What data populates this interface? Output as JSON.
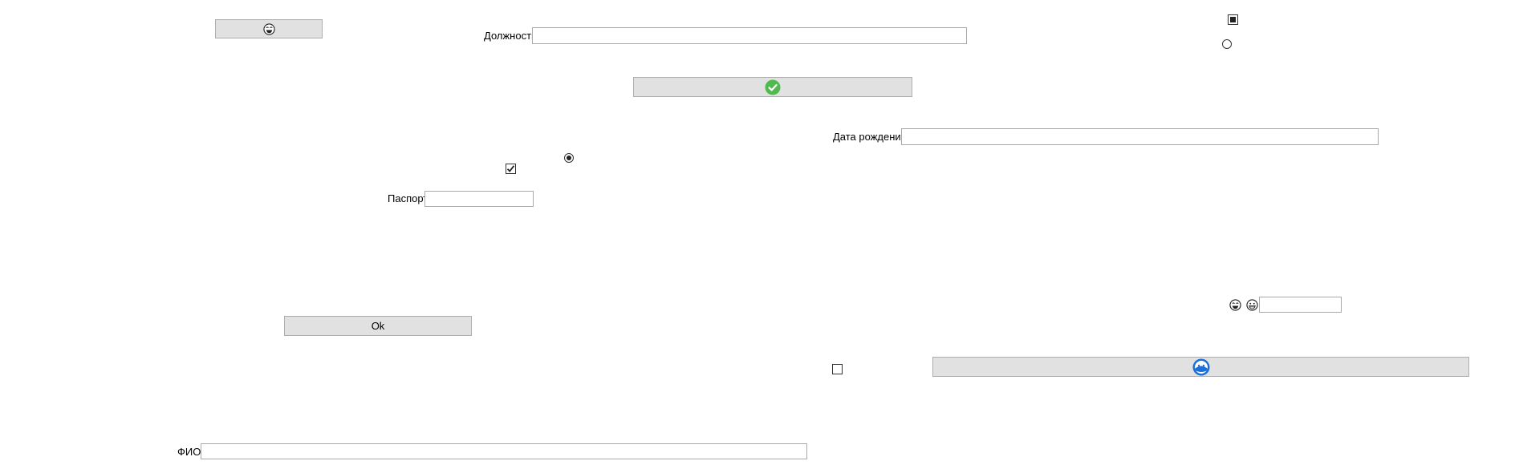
{
  "labels": {
    "position": "Должность",
    "birth_date": "Дата рождения",
    "passport": "Паспорт",
    "fio": "ФИО"
  },
  "buttons": {
    "ok_label": "Ok"
  },
  "fields": {
    "position_value": "",
    "birth_date_value": "",
    "passport_value": "",
    "fio_value": "",
    "small_value": ""
  },
  "states": {
    "checkbox_top_right": "indeterminate",
    "checkbox_middle": "checked",
    "checkbox_bottom": "unchecked",
    "radio_top_right": "unselected",
    "radio_middle": "selected"
  },
  "icons": {
    "top_left_button": "laughing-face-icon",
    "center_button": "green-check-circle-icon",
    "bottom_right_button": "blue-round-logo-icon",
    "small_field_icon_1": "laughing-face-icon",
    "small_field_icon_2": "grinning-face-icon"
  },
  "colors": {
    "button_bg": "#e1e1e1",
    "check_green": "#4fbb4f",
    "logo_blue": "#1b6fd8"
  }
}
